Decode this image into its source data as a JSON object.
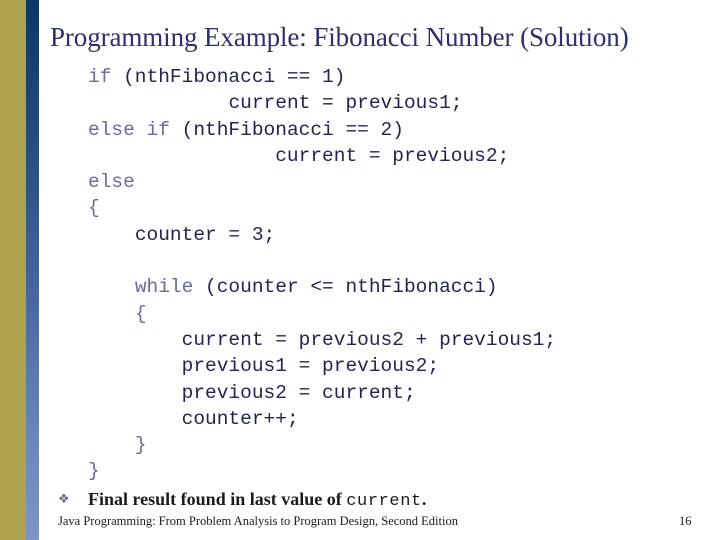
{
  "slide": {
    "title": "Programming Example: Fibonacci Number (Solution)",
    "accent_gold": "#ada34f",
    "accent_blue_top": "#0b3765",
    "accent_blue_bottom": "#7e94c4",
    "title_color": "#2f2f6e",
    "code_color": "#242450",
    "keyword_color": "#6a6aa0"
  },
  "code": {
    "lines": [
      {
        "indent": "",
        "keyword": "if",
        "rest": " (nthFibonacci == 1)"
      },
      {
        "indent": "            ",
        "keyword": "",
        "rest": "current = previous1;"
      },
      {
        "indent": "",
        "keyword": "else if",
        "rest": " (nthFibonacci == 2)"
      },
      {
        "indent": "                ",
        "keyword": "",
        "rest": "current = previous2;"
      },
      {
        "indent": "",
        "keyword": "else",
        "rest": ""
      },
      {
        "indent": "",
        "keyword": "{",
        "rest": ""
      },
      {
        "indent": "    ",
        "keyword": "",
        "rest": "counter = 3;"
      },
      {
        "indent": "",
        "keyword": "",
        "rest": ""
      },
      {
        "indent": "    ",
        "keyword": "while",
        "rest": " (counter <= nthFibonacci)"
      },
      {
        "indent": "    ",
        "keyword": "{",
        "rest": ""
      },
      {
        "indent": "        ",
        "keyword": "",
        "rest": "current = previous2 + previous1;"
      },
      {
        "indent": "        ",
        "keyword": "",
        "rest": "previous1 = previous2;"
      },
      {
        "indent": "        ",
        "keyword": "",
        "rest": "previous2 = current;"
      },
      {
        "indent": "        ",
        "keyword": "",
        "rest": "counter++;"
      },
      {
        "indent": "    ",
        "keyword": "}",
        "rest": ""
      },
      {
        "indent": "",
        "keyword": "}",
        "rest": ""
      }
    ]
  },
  "bullet": {
    "marker": "❖",
    "text_prefix": "Final result found in last value of ",
    "text_code": "current",
    "text_suffix": "."
  },
  "footer": {
    "source": "Java Programming: From Problem Analysis to Program Design, Second Edition",
    "page_number": "16"
  }
}
